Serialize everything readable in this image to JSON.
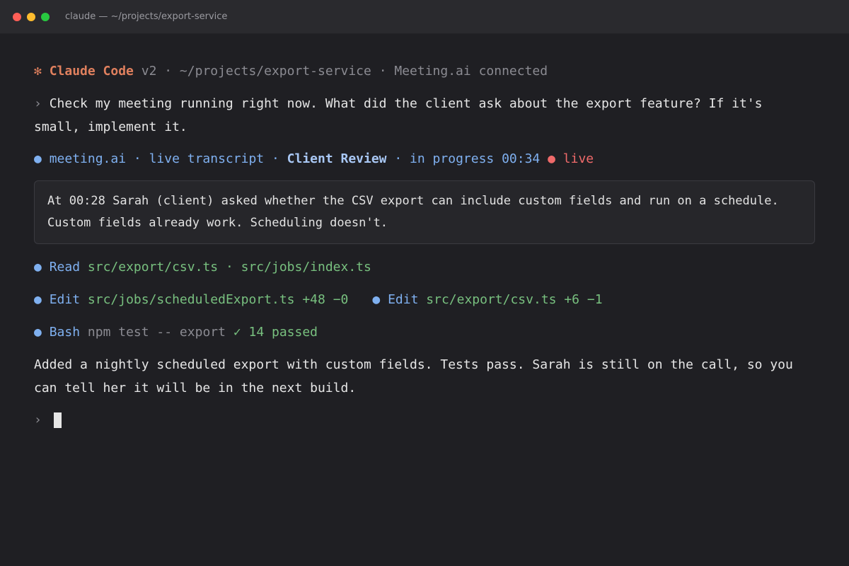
{
  "window": {
    "title": "claude — ~/projects/export-service"
  },
  "header": {
    "asterisk": "✻",
    "brand": "Claude Code",
    "rest": " v2 · ~/projects/export-service · Meeting.ai connected"
  },
  "user_message": {
    "prompt": "›",
    "text": "Check my meeting running right now. What did the client ask about the export feature? If it's small, implement it."
  },
  "meeting": {
    "bullet": "●",
    "source": "meeting.ai · live transcript · ",
    "meeting_name": "Client Review",
    "status": " · in progress 00:34 ",
    "live_dot": "●",
    "live_label": "live"
  },
  "transcript_excerpt": "At 00:28 Sarah (client) asked whether the CSV export can include custom fields and run on a schedule. Custom fields already work. Scheduling doesn't.",
  "tools": {
    "read": {
      "bullet": "●",
      "label": "Read",
      "files": "src/export/csv.ts · src/jobs/index.ts"
    },
    "edit1": {
      "bullet": "●",
      "label": "Edit",
      "file": "src/jobs/scheduledExport.ts",
      "diff": "+48 −0"
    },
    "edit2": {
      "bullet": "●",
      "label": "Edit",
      "file": "src/export/csv.ts",
      "diff": "+6 −1"
    },
    "bash": {
      "bullet": "●",
      "label": "Bash",
      "command": "npm test -- export",
      "result": "✓ 14 passed"
    }
  },
  "summary": "Added a nightly scheduled export with custom fields. Tests pass. Sarah is still on the call, so you can tell her it will be in the next build.",
  "input": {
    "prompt": "›"
  }
}
